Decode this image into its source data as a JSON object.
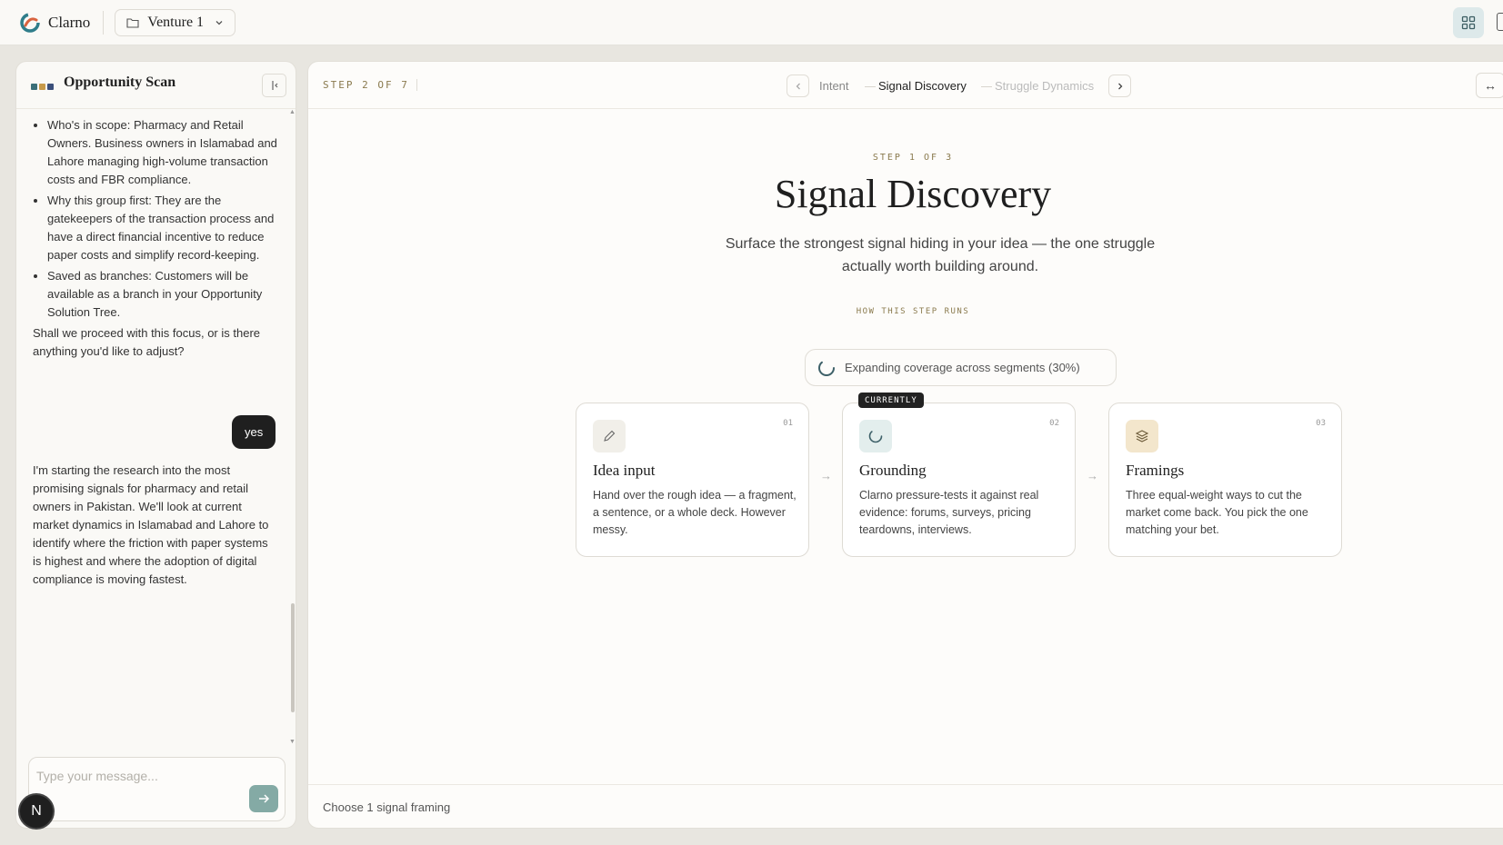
{
  "app": {
    "brand_name": "Clarno",
    "venture_label": "Venture 1",
    "colors": {
      "accent_teal": "#84aaa5",
      "badge_dark": "#222222",
      "step_gold": "#8a7a4e"
    }
  },
  "sidebar": {
    "title": "Opportunity Scan",
    "bullets": [
      "Who's in scope: Pharmacy and Retail Owners. Business owners in Islamabad and Lahore managing high-volume transaction costs and FBR compliance.",
      "Why this group first: They are the gatekeepers of the transaction process and have a direct financial incentive to reduce paper costs and simplify record-keeping.",
      "Saved as branches: Customers will be available as a branch in your Opportunity Solution Tree."
    ],
    "question": "Shall we proceed with this focus, or is there anything you'd like to adjust?",
    "user_reply": "yes",
    "assistant_reply": "I'm starting the research into the most promising signals for pharmacy and retail owners in Pakistan. We'll look at current market dynamics in Islamabad and Lahore to identify where the friction with paper systems is highest and where the adoption of digital compliance is moving fastest.",
    "composer_placeholder": "Type your message...",
    "avatar_initial": "N"
  },
  "main": {
    "step_counter": "STEP 2 OF 7",
    "breadcrumbs": [
      "Intent",
      "Signal Discovery",
      "Struggle Dynamics"
    ],
    "sub_step": "STEP 1 OF 3",
    "title": "Signal Discovery",
    "lead": "Surface the strongest signal hiding in your idea — the one struggle actually worth building around.",
    "how_label": "HOW THIS STEP RUNS",
    "progress_text": "Expanding coverage across segments (30%)",
    "progress_value": 30,
    "current_badge": "CURRENTLY",
    "cards": [
      {
        "num": "01",
        "title": "Idea input",
        "desc": "Hand over the rough idea — a fragment, a sentence, or a whole deck. However messy.",
        "icon": "pencil-icon"
      },
      {
        "num": "02",
        "title": "Grounding",
        "desc": "Clarno pressure-tests it against real evidence: forums, surveys, pricing teardowns, interviews.",
        "icon": "spinner-icon"
      },
      {
        "num": "03",
        "title": "Framings",
        "desc": "Three equal-weight ways to cut the market come back. You pick the one matching your bet.",
        "icon": "layers-icon"
      }
    ],
    "footer_text": "Choose 1 signal framing"
  }
}
